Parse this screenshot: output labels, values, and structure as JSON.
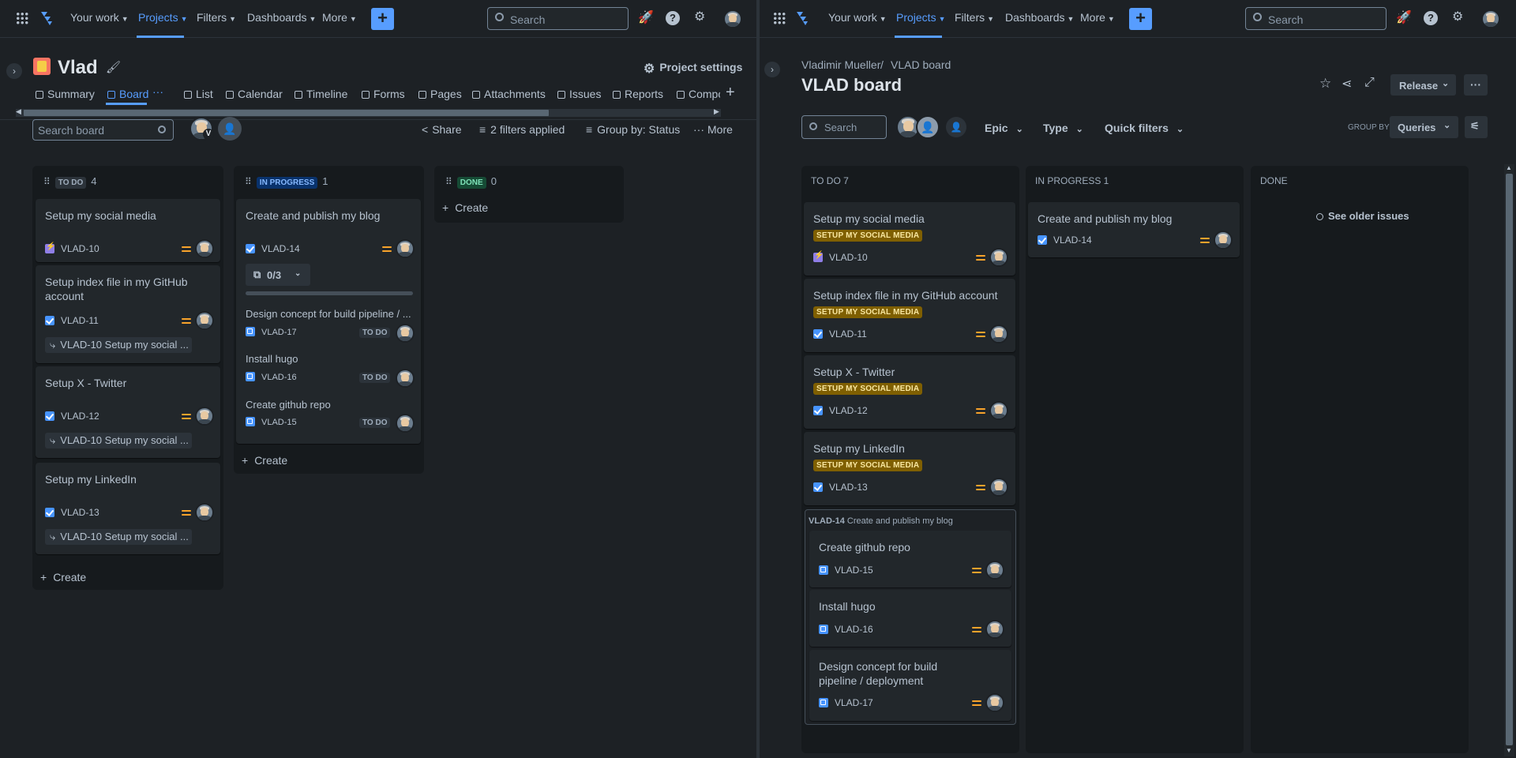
{
  "nav": {
    "your_work": "Your work",
    "projects": "Projects",
    "filters": "Filters",
    "dashboards": "Dashboards",
    "more": "More",
    "search_placeholder": "Search"
  },
  "left": {
    "project_name": "Vlad",
    "project_settings": "Project settings",
    "tabs": [
      "Summary",
      "Board",
      "List",
      "Calendar",
      "Timeline",
      "Forms",
      "Pages",
      "Attachments",
      "Issues",
      "Reports",
      "Compo"
    ],
    "search_board_placeholder": "Search board",
    "avatar_badge": "V",
    "share": "Share",
    "filters_applied": "2 filters applied",
    "group_by": "Group by: Status",
    "more": "More",
    "columns": {
      "todo": {
        "label": "TO DO",
        "count": "4"
      },
      "inprogress": {
        "label": "IN PROGRESS",
        "count": "1"
      },
      "done": {
        "label": "DONE",
        "count": "0"
      }
    },
    "create": "Create",
    "todo_cards": [
      {
        "title": "Setup my social media",
        "key": "VLAD-10"
      },
      {
        "title": "Setup index file in my GitHub account",
        "key": "VLAD-11",
        "link": "VLAD-10 Setup my social ..."
      },
      {
        "title": "Setup X - Twitter",
        "key": "VLAD-12",
        "link": "VLAD-10 Setup my social ..."
      },
      {
        "title": "Setup my LinkedIn",
        "key": "VLAD-13",
        "link": "VLAD-10 Setup my social ..."
      }
    ],
    "inprogress_card": {
      "title": "Create and publish my blog",
      "key": "VLAD-14",
      "subtask_count": "0/3",
      "subtasks": [
        {
          "title": "Design concept for build pipeline / ...",
          "key": "VLAD-17",
          "status": "TO DO"
        },
        {
          "title": "Install hugo",
          "key": "VLAD-16",
          "status": "TO DO"
        },
        {
          "title": "Create github repo",
          "key": "VLAD-15",
          "status": "TO DO"
        }
      ]
    }
  },
  "right": {
    "breadcrumb_user": "Vladimir Mueller",
    "breadcrumb_sep": "/",
    "breadcrumb_board": "VLAD board",
    "title": "VLAD board",
    "release": "Release",
    "search_placeholder": "Search",
    "epic": "Epic",
    "type": "Type",
    "quick_filters": "Quick filters",
    "group_by_label": "GROUP BY",
    "group_by_value": "Queries",
    "columns": {
      "todo": "TO DO 7",
      "inprogress": "IN PROGRESS 1",
      "done": "DONE"
    },
    "see_older": "See older issues",
    "todo_cards": [
      {
        "title": "Setup my social media",
        "epic": "SETUP MY SOCIAL MEDIA",
        "key": "VLAD-10"
      },
      {
        "title": "Setup index file in my GitHub account",
        "epic": "SETUP MY SOCIAL MEDIA",
        "key": "VLAD-11"
      },
      {
        "title": "Setup X - Twitter",
        "epic": "SETUP MY SOCIAL MEDIA",
        "key": "VLAD-12"
      },
      {
        "title": "Setup my LinkedIn",
        "epic": "SETUP MY SOCIAL MEDIA",
        "key": "VLAD-13"
      }
    ],
    "parent_group": {
      "key": "VLAD-14",
      "title": "Create and publish my blog",
      "cards": [
        {
          "title": "Create github repo",
          "key": "VLAD-15"
        },
        {
          "title": "Install hugo",
          "key": "VLAD-16"
        },
        {
          "title": "Design concept for build pipeline / deployment",
          "key": "VLAD-17"
        }
      ]
    },
    "inprogress_card": {
      "title": "Create and publish my blog",
      "key": "VLAD-14"
    }
  },
  "colors": {
    "bg": "#1d2125",
    "accent": "#579dff",
    "priority": "#f8a32b",
    "epic_bg": "#7f5f01"
  }
}
